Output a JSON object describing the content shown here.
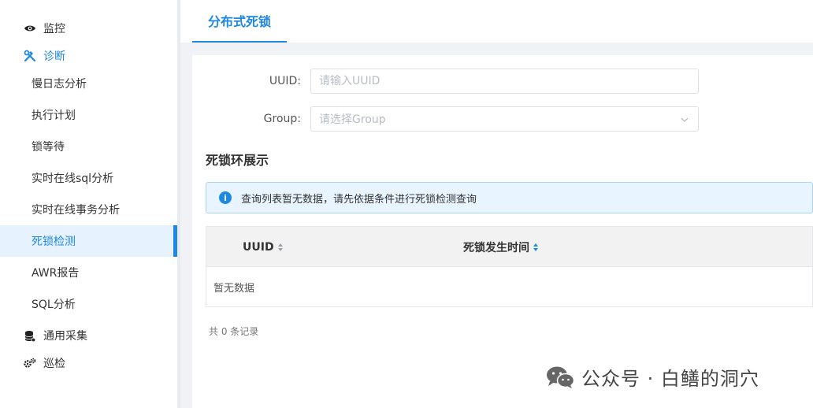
{
  "sidebar": {
    "groups": [
      {
        "label": "监控",
        "icon": "eye-icon"
      },
      {
        "label": "诊断",
        "icon": "tools-icon"
      },
      {
        "label": "通用采集",
        "icon": "database-icon"
      },
      {
        "label": "巡检",
        "icon": "gears-icon"
      }
    ],
    "items": [
      {
        "label": "慢日志分析"
      },
      {
        "label": "执行计划"
      },
      {
        "label": "锁等待"
      },
      {
        "label": "实时在线sql分析"
      },
      {
        "label": "实时在线事务分析"
      },
      {
        "label": "死锁检测"
      },
      {
        "label": "AWR报告"
      },
      {
        "label": "SQL分析"
      }
    ],
    "selected": "死锁检测"
  },
  "tabs": [
    {
      "label": "分布式死锁"
    }
  ],
  "form": {
    "uuid_label": "UUID:",
    "uuid_placeholder": "请输入UUID",
    "uuid_value": "",
    "group_label": "Group:",
    "group_placeholder": "请选择Group"
  },
  "section_title": "死锁环展示",
  "alert_text": "查询列表暂无数据，请先依据条件进行死锁检测查询",
  "table": {
    "columns": [
      "UUID",
      "死锁发生时间"
    ],
    "empty_text": "暂无数据"
  },
  "pagination": {
    "total_text": "共 0 条记录"
  },
  "watermark": "公众号 · 白鳝的洞穴",
  "colors": {
    "accent": "#1e88e5",
    "selected_bg": "#e6f3ff",
    "alert_bg": "#e8f4ff"
  }
}
